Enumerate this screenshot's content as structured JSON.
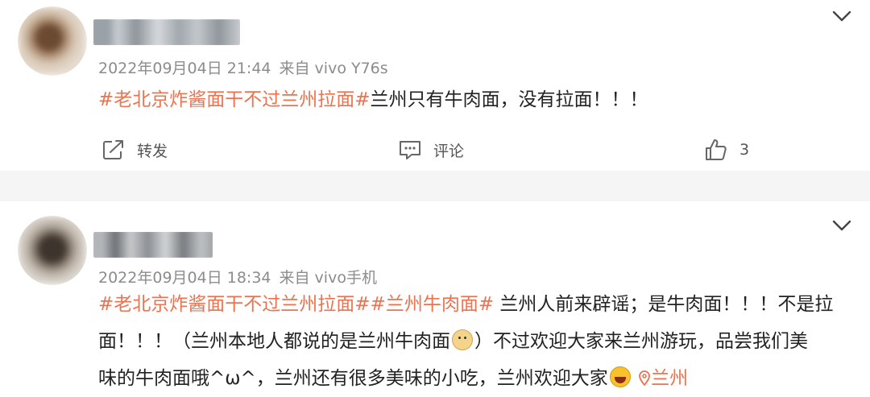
{
  "posts": [
    {
      "timestamp": "2022年09月04日 21:44",
      "source": "来自 vivo Y76s",
      "content": {
        "tag1": "#老北京炸酱面干不过兰州拉面#",
        "text1": "兰州只有牛肉面，没有拉面！！！"
      },
      "actions": {
        "repost_label": "转发",
        "comment_label": "评论",
        "like_count": "3"
      }
    },
    {
      "timestamp": "2022年09月04日 18:34",
      "source": "来自 vivo手机",
      "content": {
        "tag1": "#老北京炸酱面干不过兰州拉面#",
        "tag2": "#兰州牛肉面#",
        "line1_text": "兰州人前来辟谣；是牛肉面！！！不是拉",
        "line2_text_a": "面！！！（兰州本地人都说的是兰州牛肉面",
        "line2_text_b": "）不过欢迎大家来兰州游玩，品尝我们美",
        "line3_text": "味的牛肉面哦^ω^，兰州还有很多美味的小吃，兰州欢迎大家",
        "location": "兰州"
      }
    }
  ],
  "colors": {
    "tag": "#eb7350",
    "meta": "#8c8c8c",
    "divider": "#f5f5f5"
  },
  "icons": {
    "menu": "chevron-down-icon",
    "repost": "repost-icon",
    "comment": "comment-icon",
    "like": "thumbs-up-icon",
    "location": "location-pin-icon"
  }
}
